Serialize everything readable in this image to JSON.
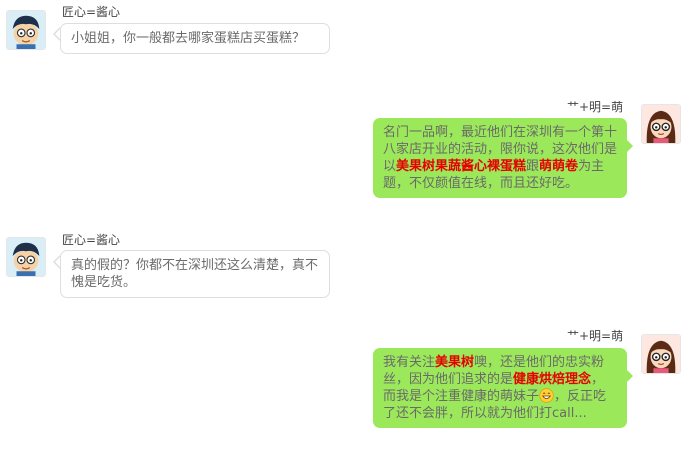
{
  "colors": {
    "right_bubble": "#9be85a",
    "highlight": "#e60000",
    "left_border": "#dedede"
  },
  "icons": {
    "boy_avatar": "boy-avatar",
    "girl_avatar": "girl-avatar",
    "emoji": "grin-emoji"
  },
  "messages": [
    {
      "sender": "匠心=酱心",
      "side": "left",
      "text": "小姐姐，你一般都去哪家蛋糕店买蛋糕？"
    },
    {
      "sender": "艹+明=萌",
      "side": "right",
      "parts": [
        "名门一品啊，最近他们在深圳有一个第十八家店开业的活动，限你说，这次他们是以",
        "美果树果蔬酱心裸蛋糕",
        "跟",
        "萌萌卷",
        "为主题，不仅颜值在线，而且还好吃。"
      ]
    },
    {
      "sender": "匠心=酱心",
      "side": "left",
      "text": "真的假的？你都不在深圳还这么清楚，真不愧是吃货。"
    },
    {
      "sender": "艹+明=萌",
      "side": "right",
      "parts": [
        "我有关注",
        "美果树",
        "噢，还是他们的忠实粉丝，因为他们追求的是",
        "健康烘焙理念",
        "，而我是个注重健康的萌妹子",
        "，反正吃了还不会胖，所以就为他们打call..."
      ]
    }
  ]
}
